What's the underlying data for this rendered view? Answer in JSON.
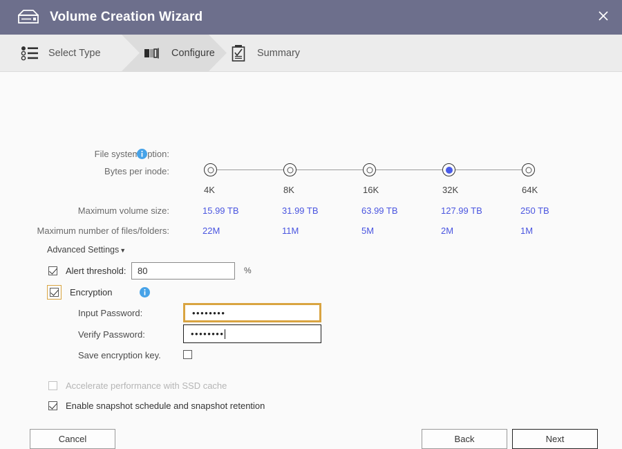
{
  "window": {
    "title": "Volume Creation Wizard",
    "icon": "nas-enclosure-icon",
    "close_label": "×",
    "header_color": "#6d6f8c"
  },
  "steps": [
    {
      "label": "Select Type",
      "icon": "list-icon",
      "active": false
    },
    {
      "label": "Configure",
      "icon": "storage-blocks-icon",
      "active": true
    },
    {
      "label": "Summary",
      "icon": "clipboard-check-icon",
      "active": false
    }
  ],
  "form": {
    "file_system_option_label": "File system option:",
    "file_system_info_icon": "info-icon",
    "bytes_per_inode_label": "Bytes per inode:",
    "maximum_volume_size_label": "Maximum volume size:",
    "maximum_files_label": "Maximum number of files/folders:",
    "advanced_settings_label": "Advanced Settings",
    "advanced_settings_caret": "▼",
    "alert_threshold_label": "Alert threshold:",
    "alert_threshold_value": "80",
    "alert_threshold_unit": "%",
    "encryption_label": "Encryption",
    "encryption_info_icon": "info-icon",
    "input_password_label": "Input Password:",
    "input_password_value": "••••••••",
    "verify_password_label": "Verify Password:",
    "verify_password_value": "••••••••",
    "save_encryption_key_label": "Save encryption key.",
    "ssd_cache_label": "Accelerate performance with SSD cache",
    "snapshot_label": "Enable snapshot schedule and snapshot retention"
  },
  "inode_table": {
    "options": [
      {
        "tick": "4K",
        "max_volume_size": "15.99 TB",
        "max_files": "22M",
        "selected": false
      },
      {
        "tick": "8K",
        "max_volume_size": "31.99 TB",
        "max_files": "11M",
        "selected": false
      },
      {
        "tick": "16K",
        "max_volume_size": "63.99 TB",
        "max_files": "5M",
        "selected": false
      },
      {
        "tick": "32K",
        "max_volume_size": "127.99 TB",
        "max_files": "2M",
        "selected": true
      },
      {
        "tick": "64K",
        "max_volume_size": "250 TB",
        "max_files": "1M",
        "selected": false
      }
    ]
  },
  "footer": {
    "cancel_label": "Cancel",
    "back_label": "Back",
    "next_label": "Next"
  },
  "colors": {
    "header": "#6d6f8c",
    "value_blue": "#4a55e0",
    "focus_gold": "#d9a441",
    "info_blue": "#47a3e8"
  }
}
